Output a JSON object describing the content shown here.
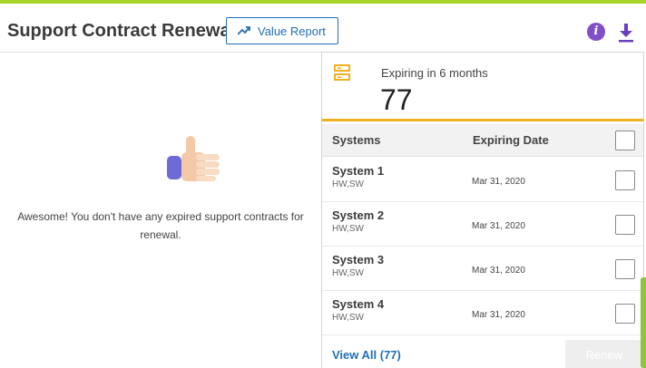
{
  "header": {
    "title": "Support Contract Renewals",
    "value_report_label": "Value Report",
    "info_icon": "info-icon",
    "download_icon": "download-icon"
  },
  "empty_state": {
    "icon": "thumbs-up-icon",
    "message": "Awesome! You don't have any expired support contracts for renewal."
  },
  "summary": {
    "icon": "server-icon",
    "label": "Expiring in 6 months",
    "count": "77"
  },
  "table": {
    "columns": [
      "Systems",
      "Expiring Date"
    ],
    "rows": [
      {
        "name": "System 1",
        "type": "HW,SW",
        "date": "Mar 31, 2020"
      },
      {
        "name": "System 2",
        "type": "HW,SW",
        "date": "Mar 31, 2020"
      },
      {
        "name": "System 3",
        "type": "HW,SW",
        "date": "Mar 31, 2020"
      },
      {
        "name": "System 4",
        "type": "HW,SW",
        "date": "Mar 31, 2020"
      }
    ]
  },
  "footer": {
    "view_all_label": "View All (77)",
    "renew_label": "Renew"
  },
  "colors": {
    "top_accent": "#a8d32a",
    "primary_blue": "#1f6fb5",
    "info_purple": "#8050c8",
    "summary_accent": "#f0b01f"
  }
}
